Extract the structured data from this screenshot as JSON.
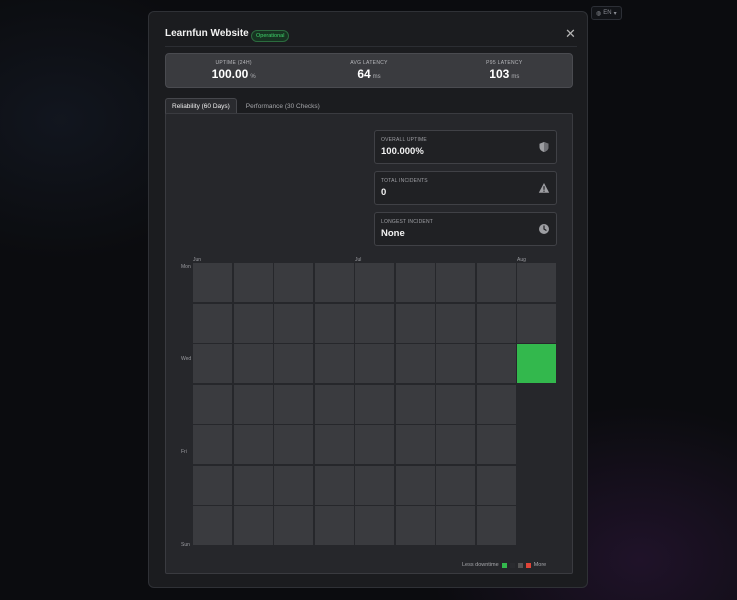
{
  "language": {
    "label": "EN"
  },
  "modal": {
    "title": "Learnfun Website",
    "status_badge": "Operational",
    "close_symbol": "✕"
  },
  "stats": [
    {
      "label": "UPTIME (24H)",
      "value": "100.00",
      "unit": "%"
    },
    {
      "label": "AVG LATENCY",
      "value": "64",
      "unit": "ms"
    },
    {
      "label": "P95 LATENCY",
      "value": "103",
      "unit": "ms"
    }
  ],
  "tabs": [
    {
      "label": "Reliability (60 Days)",
      "active": true
    },
    {
      "label": "Performance (30 Checks)",
      "active": false
    }
  ],
  "cards": [
    {
      "label": "OVERALL UPTIME",
      "value": "100.000%",
      "icon": "shield-icon"
    },
    {
      "label": "TOTAL INCIDENTS",
      "value": "0",
      "icon": "warning-icon"
    },
    {
      "label": "LONGEST INCIDENT",
      "value": "None",
      "icon": "clock-icon"
    }
  ],
  "heatmap": {
    "months": [
      "Jun",
      "Jul",
      "Aug"
    ],
    "days": [
      "Mon",
      "Wed",
      "Fri",
      "Sun"
    ],
    "legend_less": "Less downtime",
    "legend_more": "More",
    "colors": {
      "empty": "#3a3b3f",
      "good": "#33b84d",
      "mid": "#555555",
      "bad": "#e04438"
    },
    "highlight_day": "Wed, last week"
  }
}
